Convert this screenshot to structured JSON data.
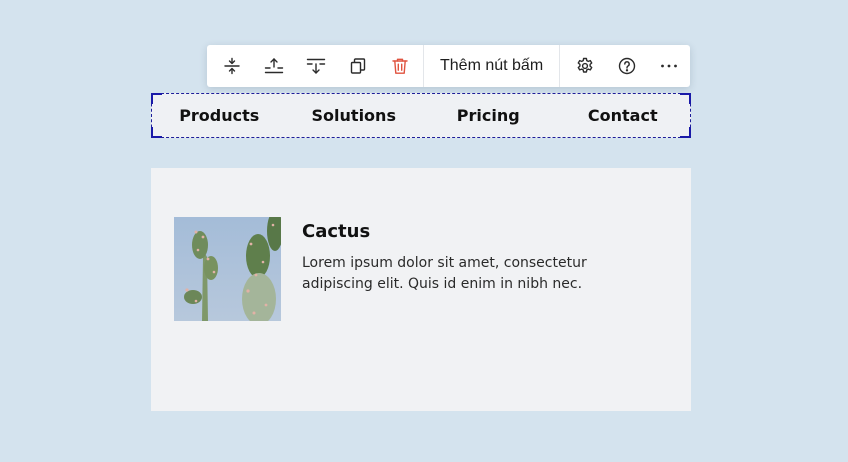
{
  "toolbar": {
    "icons": [
      {
        "name": "fit-height-icon"
      },
      {
        "name": "insert-above-icon"
      },
      {
        "name": "insert-below-icon"
      },
      {
        "name": "duplicate-icon"
      },
      {
        "name": "delete-icon",
        "color": "#e0533f"
      }
    ],
    "add_button_label": "Thêm nút bấm",
    "settings_icon": "gear-icon",
    "help_icon": "help-circle-icon",
    "more_icon": "more-horizontal-icon"
  },
  "nav": {
    "selected": true,
    "items": [
      {
        "label": "Products"
      },
      {
        "label": "Solutions"
      },
      {
        "label": "Pricing"
      },
      {
        "label": "Contact"
      }
    ]
  },
  "card": {
    "image": "cactus-photo",
    "title": "Cactus",
    "text": "Lorem ipsum dolor sit amet, consectetur adipiscing elit. Quis id enim in nibh nec."
  },
  "colors": {
    "page_background": "#d4e3ee",
    "selection_border": "#1a1aa8",
    "delete_accent": "#e0533f",
    "card_background": "#f1f2f4"
  }
}
